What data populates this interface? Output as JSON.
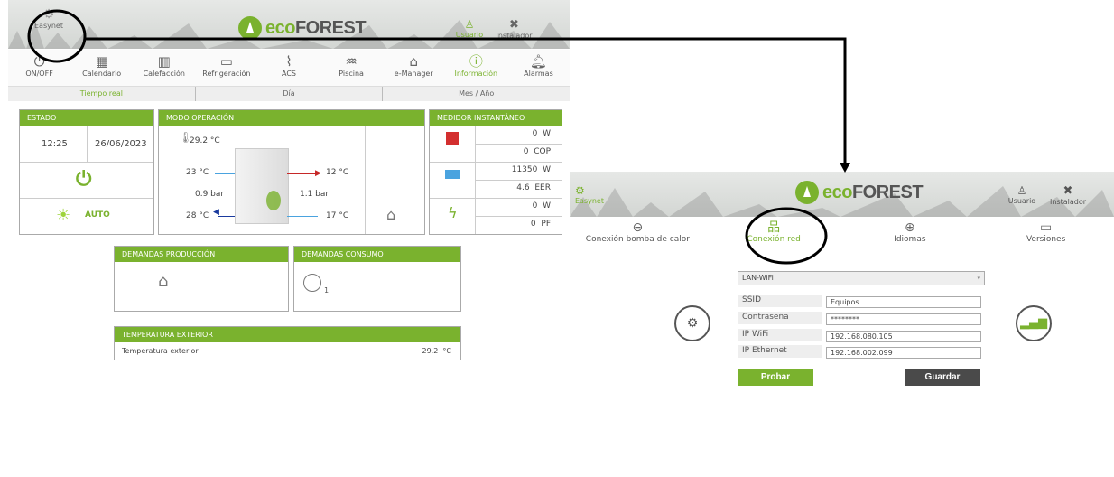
{
  "left": {
    "header": {
      "easynet_label": "Easynet",
      "brand_prefix": "eco",
      "brand_suffix": "FOREST",
      "usuario_label": "Usuario",
      "instalador_label": "Instalador"
    },
    "nav": [
      {
        "label": "ON/OFF",
        "icon": "power-icon"
      },
      {
        "label": "Calendario",
        "icon": "calendar-icon"
      },
      {
        "label": "Calefacción",
        "icon": "radiator-icon"
      },
      {
        "label": "Refrigeración",
        "icon": "ac-icon"
      },
      {
        "label": "ACS",
        "icon": "shower-icon"
      },
      {
        "label": "Piscina",
        "icon": "pool-icon"
      },
      {
        "label": "e-Manager",
        "icon": "home-icon"
      },
      {
        "label": "Información",
        "icon": "info-icon"
      },
      {
        "label": "Alarmas",
        "icon": "bell-icon"
      }
    ],
    "subnav": [
      "Tiempo real",
      "Día",
      "Mes / Año"
    ],
    "estado": {
      "title": "ESTADO",
      "time": "12:25",
      "date": "26/06/2023",
      "mode": "AUTO"
    },
    "modo": {
      "title": "MODO OPERACIÓN",
      "temp_top": "29.2 °C",
      "in_left_temp": "23 °C",
      "out_right_temp": "12 °C",
      "left_pressure": "0.9 bar",
      "right_pressure": "1.1 bar",
      "out_left_temp": "28 °C",
      "in_right_temp": "17 °C"
    },
    "medidor": {
      "title": "MEDIDOR INSTANTÁNEO",
      "rows": [
        {
          "value": "0",
          "unit": "W"
        },
        {
          "value": "0",
          "unit": "COP"
        },
        {
          "value": "11350",
          "unit": "W"
        },
        {
          "value": "4.6",
          "unit": "EER"
        },
        {
          "value": "0",
          "unit": "W"
        },
        {
          "value": "0",
          "unit": "PF"
        }
      ]
    },
    "dem_prod": {
      "title": "DEMANDAS PRODUCCIÓN"
    },
    "dem_cons": {
      "title": "DEMANDAS CONSUMO",
      "sub": "1"
    },
    "temp_ext": {
      "title": "TEMPERATURA EXTERIOR",
      "label": "Temperatura exterior",
      "value": "29.2",
      "unit": "°C"
    }
  },
  "right": {
    "header": {
      "easynet_label": "Easynet",
      "brand_prefix": "eco",
      "brand_suffix": "FOREST",
      "usuario_label": "Usuario",
      "instalador_label": "Instalador"
    },
    "tabs": [
      {
        "label": "Conexión bomba de calor",
        "icon": "heat-pump-icon"
      },
      {
        "label": "Conexión red",
        "icon": "network-icon"
      },
      {
        "label": "Idiomas",
        "icon": "globe-icon"
      },
      {
        "label": "Versiones",
        "icon": "monitor-icon"
      }
    ],
    "net_type": "LAN-WiFi",
    "fields": [
      {
        "label": "SSID",
        "value": "Equipos"
      },
      {
        "label": "Contraseña",
        "value": "********"
      },
      {
        "label": "IP WiFi",
        "value": "192.168.080.105"
      },
      {
        "label": "IP Ethernet",
        "value": "192.168.002.099"
      }
    ],
    "test_button": "Probar",
    "save_button": "Guardar"
  },
  "colors": {
    "accent": "#7ab22e",
    "dark_button": "#4a4a4a",
    "annotation": "#000000"
  }
}
